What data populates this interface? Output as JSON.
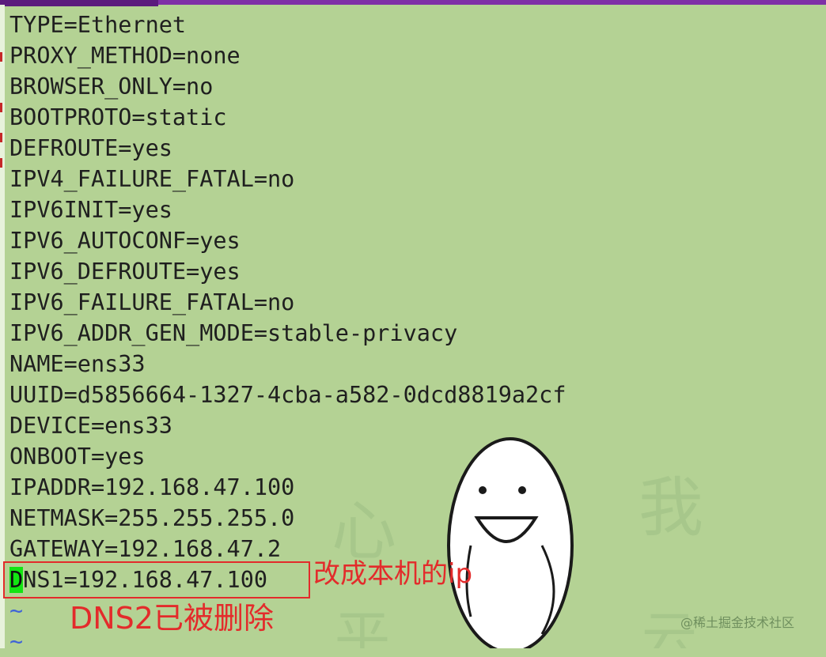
{
  "editor": {
    "lines": [
      "TYPE=Ethernet",
      "PROXY_METHOD=none",
      "BROWSER_ONLY=no",
      "BOOTPROTO=static",
      "DEFROUTE=yes",
      "IPV4_FAILURE_FATAL=no",
      "IPV6INIT=yes",
      "IPV6_AUTOCONF=yes",
      "IPV6_DEFROUTE=yes",
      "IPV6_FAILURE_FATAL=no",
      "IPV6_ADDR_GEN_MODE=stable-privacy",
      "NAME=ens33",
      "UUID=d5856664-1327-4cba-a582-0dcd8819a2cf",
      "DEVICE=ens33",
      "ONBOOT=yes",
      "IPADDR=192.168.47.100",
      "NETMASK=255.255.255.0",
      "GATEWAY=192.168.47.2"
    ],
    "cursor_line": {
      "cursor_char": "D",
      "rest": "NS1=192.168.47.100"
    },
    "tilde_lines": [
      "~",
      "~"
    ]
  },
  "annotations": {
    "note1": "改成本机的ip",
    "note2": "DNS2已被删除"
  },
  "watermark": "@稀土掘金技术社区",
  "colors": {
    "background": "#b4d294",
    "accent_bar": "#7f2fa7",
    "annotation_red": "#e32b2b",
    "cursor_green": "#12e512",
    "tilde_blue": "#3f63d8"
  }
}
